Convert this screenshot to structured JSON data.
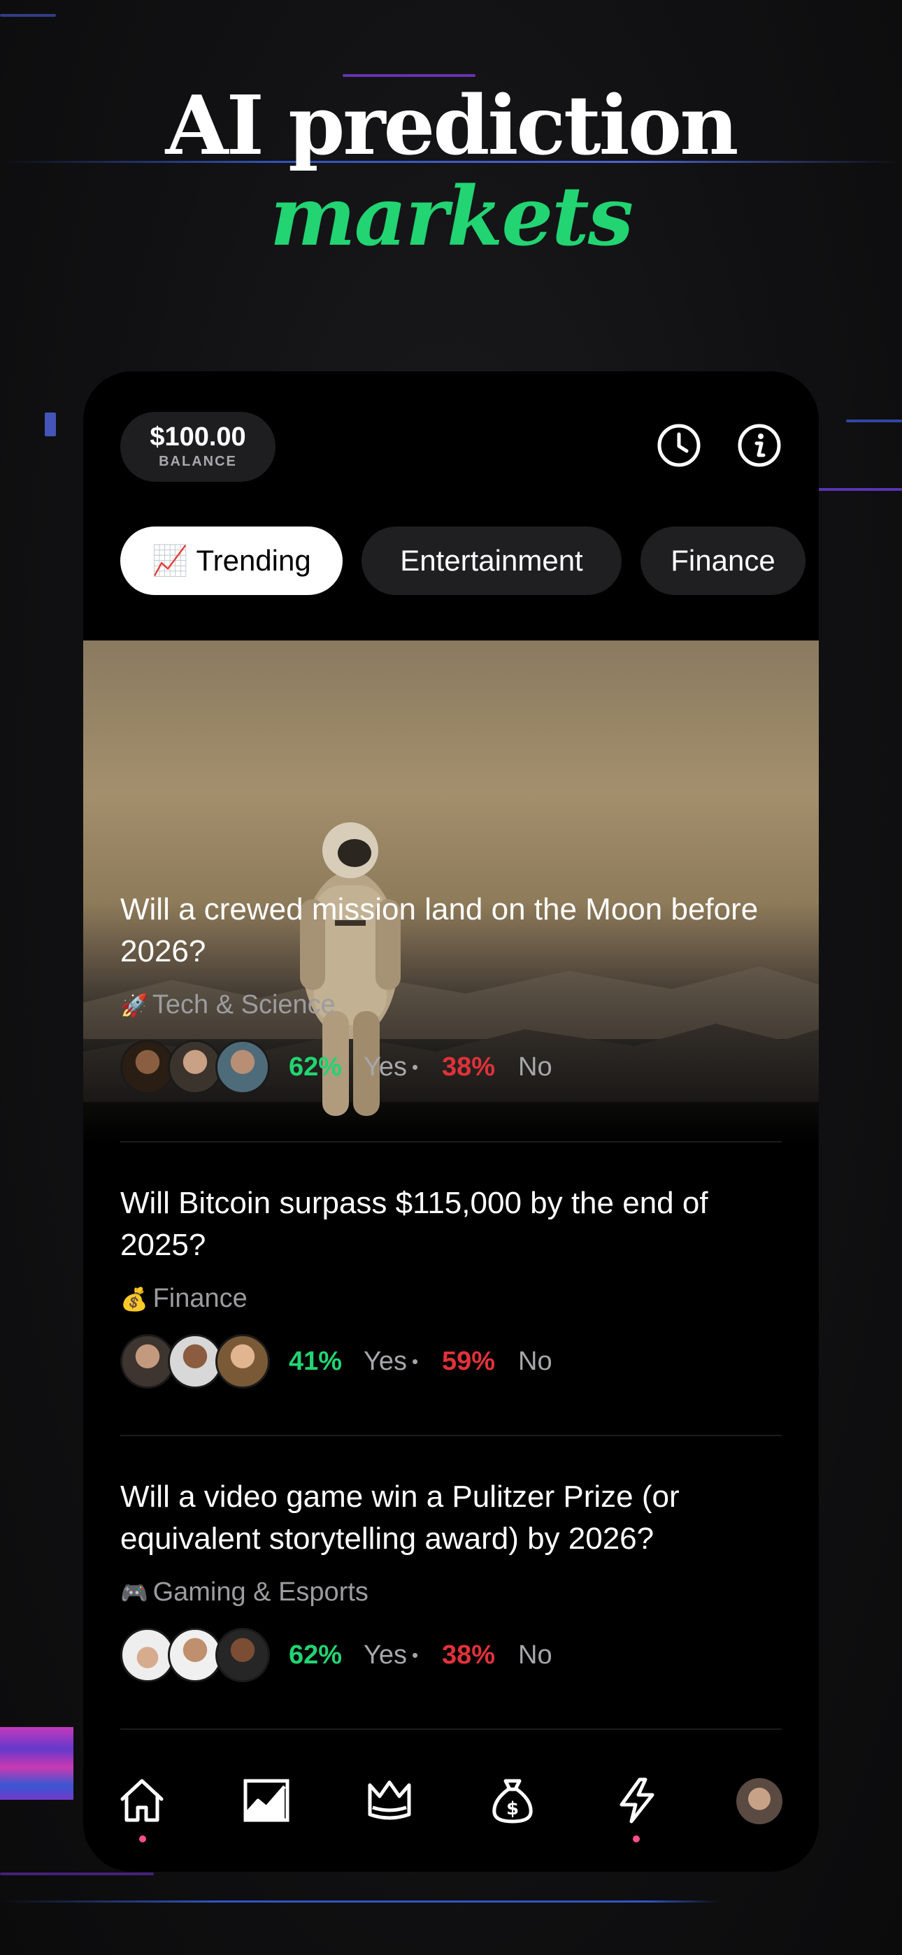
{
  "headline": {
    "line1": "AI prediction",
    "line2": "markets"
  },
  "balance": {
    "amount": "$100.00",
    "label": "BALANCE"
  },
  "header_icons": [
    "clock-icon",
    "info-icon"
  ],
  "tabs": [
    {
      "label": "Trending",
      "emoji": "📈",
      "active": true
    },
    {
      "label": "Entertainment",
      "active": false
    },
    {
      "label": "Finance",
      "active": false
    }
  ],
  "markets": [
    {
      "question": "Will a crewed mission land on the Moon before 2026?",
      "category": "Tech & Science",
      "category_emoji": "🚀",
      "yes_pct": "62%",
      "yes_label": "Yes",
      "no_pct": "38%",
      "no_label": "No",
      "featured": true
    },
    {
      "question": "Will Bitcoin surpass $115,000 by the end of 2025?",
      "category": "Finance",
      "category_emoji": "💰",
      "yes_pct": "41%",
      "yes_label": "Yes",
      "no_pct": "59%",
      "no_label": "No"
    },
    {
      "question": "Will a video game win a Pulitzer Prize (or equivalent storytelling award) by 2026?",
      "category": "Gaming & Esports",
      "category_emoji": "🎮",
      "yes_pct": "62%",
      "yes_label": "Yes",
      "no_pct": "38%",
      "no_label": "No"
    }
  ],
  "bottom_nav": [
    {
      "icon": "home-icon",
      "indicator": true
    },
    {
      "icon": "chart-icon",
      "indicator": false
    },
    {
      "icon": "crown-icon",
      "indicator": false
    },
    {
      "icon": "money-bag-icon",
      "indicator": false
    },
    {
      "icon": "lightning-icon",
      "indicator": true
    },
    {
      "icon": "profile-avatar",
      "indicator": false
    }
  ],
  "colors": {
    "accent_green": "#22d472",
    "no_red": "#e0323a",
    "indicator_pink": "#ff4f8e",
    "background": "#000000"
  }
}
